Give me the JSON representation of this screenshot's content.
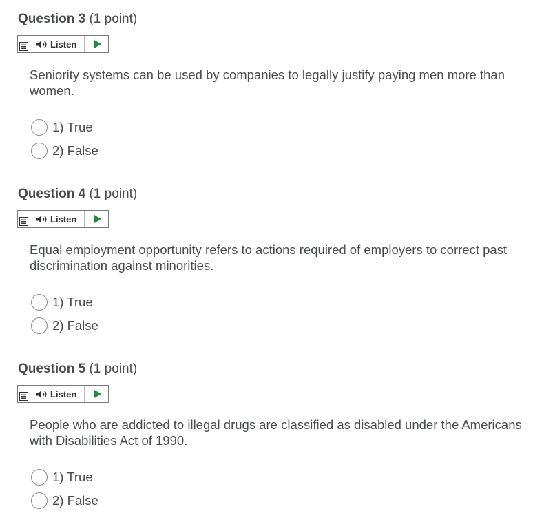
{
  "questions": [
    {
      "number": "Question 3",
      "points": "(1 point)",
      "listen_label": "Listen",
      "text": "Seniority systems can be used by companies to legally justify paying men more than women.",
      "options": [
        "1) True",
        "2) False"
      ]
    },
    {
      "number": "Question 4",
      "points": "(1 point)",
      "listen_label": "Listen",
      "text": "Equal employment opportunity refers to actions required of employers to correct past discrimination against minorities.",
      "options": [
        "1) True",
        "2) False"
      ]
    },
    {
      "number": "Question 5",
      "points": "(1 point)",
      "listen_label": "Listen",
      "text": "People who are addicted to illegal drugs are classified as disabled under the Americans with Disabilities Act of 1990.",
      "options": [
        "1) True",
        "2) False"
      ]
    }
  ],
  "icons": {
    "menu": "menu-icon",
    "speaker": "speaker-icon",
    "play": "play-icon"
  },
  "colors": {
    "text": "#494c4e",
    "play": "#1e8e3e",
    "radio_border": "#868c8f"
  }
}
